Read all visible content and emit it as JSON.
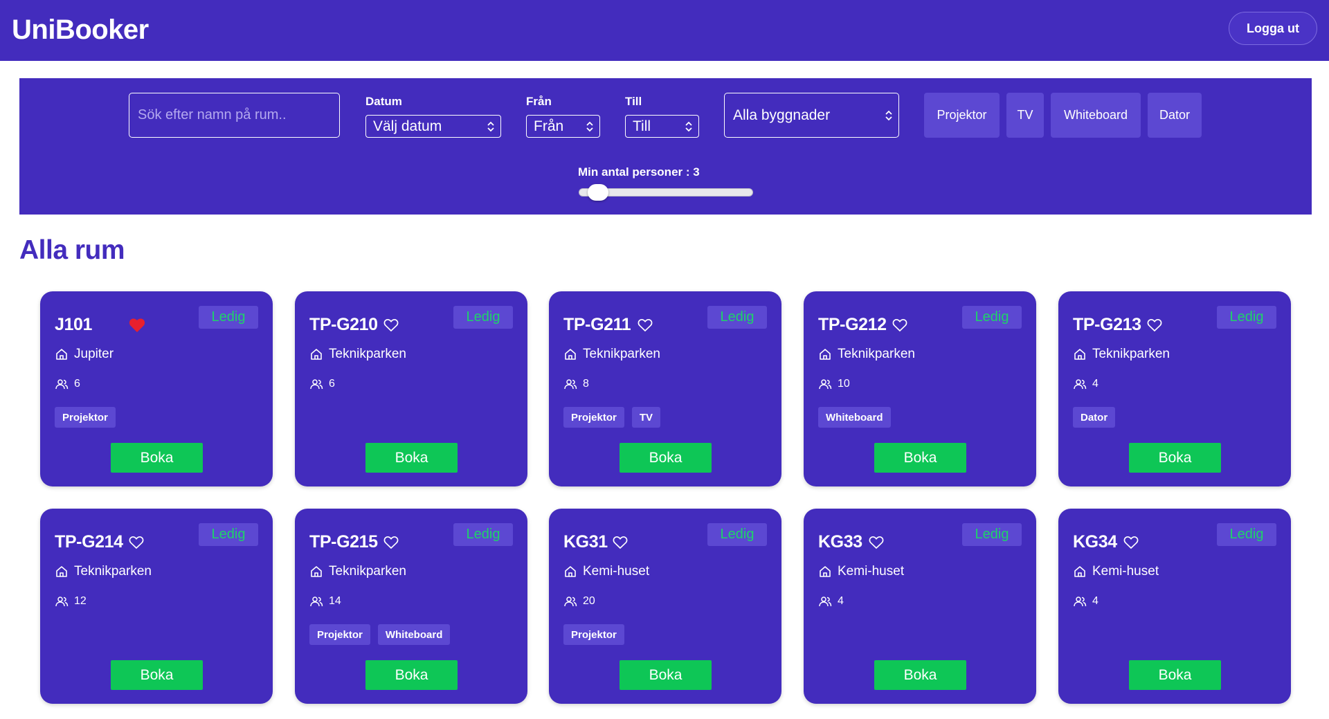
{
  "header": {
    "brand": "UniBooker",
    "logout_label": "Logga ut"
  },
  "filters": {
    "search_placeholder": "Sök efter namn på rum..",
    "date_label": "Datum",
    "date_value": "Välj datum",
    "from_label": "Från",
    "from_value": "Från",
    "to_label": "Till",
    "to_value": "Till",
    "building_value": "Alla byggnader",
    "equipment": [
      "Projektor",
      "TV",
      "Whiteboard",
      "Dator"
    ],
    "min_persons_label": "Min antal personer : 3",
    "min_persons_value": 3
  },
  "section_title": "Alla rum",
  "colors": {
    "primary": "#432cbd",
    "chip": "#5c48d2",
    "available": "#1fd26a",
    "book_button": "#0ec656",
    "favorite": "#e8202d"
  },
  "rooms": [
    {
      "name": "J101",
      "favorite": true,
      "status": "Ledig",
      "building": "Jupiter",
      "capacity": "6",
      "equipment": [
        "Projektor"
      ],
      "book_label": "Boka"
    },
    {
      "name": "TP-G210",
      "favorite": false,
      "status": "Ledig",
      "building": "Teknikparken",
      "capacity": "6",
      "equipment": [],
      "book_label": "Boka"
    },
    {
      "name": "TP-G211",
      "favorite": false,
      "status": "Ledig",
      "building": "Teknikparken",
      "capacity": "8",
      "equipment": [
        "Projektor",
        "TV"
      ],
      "book_label": "Boka"
    },
    {
      "name": "TP-G212",
      "favorite": false,
      "status": "Ledig",
      "building": "Teknikparken",
      "capacity": "10",
      "equipment": [
        "Whiteboard"
      ],
      "book_label": "Boka"
    },
    {
      "name": "TP-G213",
      "favorite": false,
      "status": "Ledig",
      "building": "Teknikparken",
      "capacity": "4",
      "equipment": [
        "Dator"
      ],
      "book_label": "Boka"
    },
    {
      "name": "TP-G214",
      "favorite": false,
      "status": "Ledig",
      "building": "Teknikparken",
      "capacity": "12",
      "equipment": [],
      "book_label": "Boka"
    },
    {
      "name": "TP-G215",
      "favorite": false,
      "status": "Ledig",
      "building": "Teknikparken",
      "capacity": "14",
      "equipment": [
        "Projektor",
        "Whiteboard"
      ],
      "book_label": "Boka"
    },
    {
      "name": "KG31",
      "favorite": false,
      "status": "Ledig",
      "building": "Kemi-huset",
      "capacity": "20",
      "equipment": [
        "Projektor"
      ],
      "book_label": "Boka"
    },
    {
      "name": "KG33",
      "favorite": false,
      "status": "Ledig",
      "building": "Kemi-huset",
      "capacity": "4",
      "equipment": [],
      "book_label": "Boka"
    },
    {
      "name": "KG34",
      "favorite": false,
      "status": "Ledig",
      "building": "Kemi-huset",
      "capacity": "4",
      "equipment": [],
      "book_label": "Boka"
    }
  ]
}
